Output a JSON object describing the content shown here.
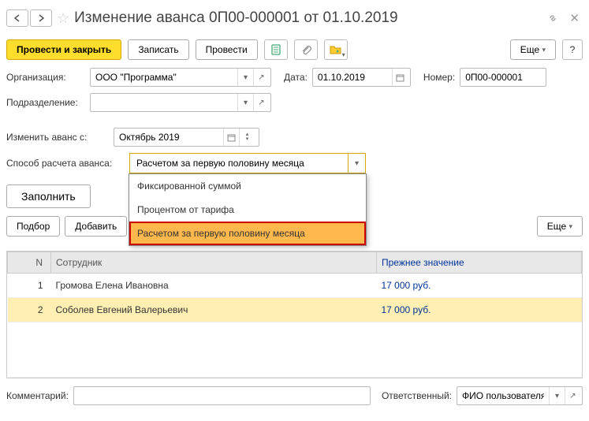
{
  "title": "Изменение аванса 0П00-000001 от 01.10.2019",
  "toolbar": {
    "post_close": "Провести и закрыть",
    "write": "Записать",
    "post": "Провести",
    "more": "Еще",
    "help": "?"
  },
  "header": {
    "org_label": "Организация:",
    "org_value": "ООО \"Программа\"",
    "date_label": "Дата:",
    "date_value": "01.10.2019",
    "number_label": "Номер:",
    "number_value": "0П00-000001",
    "dept_label": "Подразделение:",
    "dept_value": ""
  },
  "params": {
    "change_from_label": "Изменить аванс с:",
    "change_from_value": "Октябрь 2019",
    "method_label": "Способ расчета аванса:",
    "method_value": "Расчетом за первую половину месяца",
    "method_options": {
      "o1": "Фиксированной суммой",
      "o2": "Процентом от тарифа",
      "o3": "Расчетом за первую половину месяца"
    }
  },
  "actions": {
    "fill": "Заполнить",
    "pick": "Подбор",
    "add": "Добавить",
    "more": "Еще"
  },
  "table": {
    "col_n": "N",
    "col_emp": "Сотрудник",
    "col_prev": "Прежнее значение",
    "rows": {
      "r1": {
        "n": "1",
        "emp": "Громова Елена Ивановна",
        "val": "17 000 руб."
      },
      "r2": {
        "n": "2",
        "emp": "Соболев Евгений Валерьевич",
        "val": "17 000 руб."
      }
    }
  },
  "footer": {
    "comment_label": "Комментарий:",
    "comment_value": "",
    "resp_label": "Ответственный:",
    "resp_value": "ФИО пользователя"
  }
}
